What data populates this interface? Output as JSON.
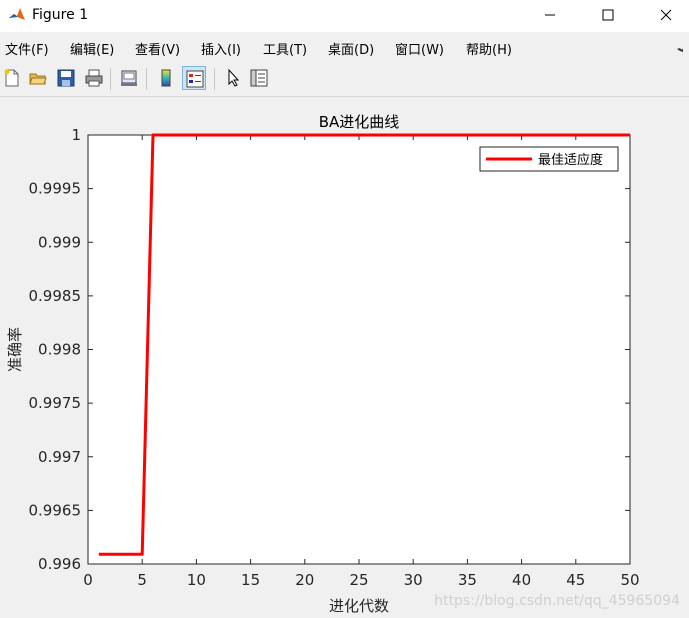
{
  "window": {
    "title": "Figure 1",
    "menu": [
      "文件(F)",
      "编辑(E)",
      "查看(V)",
      "插入(I)",
      "工具(T)",
      "桌面(D)",
      "窗口(W)",
      "帮助(H)"
    ]
  },
  "toolbar": {
    "icons": [
      "new-figure-icon",
      "open-file-icon",
      "save-icon",
      "print-icon",
      "link-plot-icon",
      "colorbar-icon",
      "legend-icon",
      "edit-plot-arrow-icon",
      "property-inspector-icon"
    ]
  },
  "chart_data": {
    "type": "line",
    "title": "BA进化曲线",
    "xlabel": "进化代数",
    "ylabel": "准确率",
    "xlim": [
      0,
      50
    ],
    "ylim": [
      0.996,
      1
    ],
    "xticks": [
      0,
      5,
      10,
      15,
      20,
      25,
      30,
      35,
      40,
      45,
      50
    ],
    "yticks": [
      0.996,
      0.9965,
      0.997,
      0.9975,
      0.998,
      0.9985,
      0.999,
      0.9995,
      1
    ],
    "ytick_labels": [
      "0.996",
      "0.9965",
      "0.997",
      "0.9975",
      "0.998",
      "0.9985",
      "0.999",
      "0.9995",
      "1"
    ],
    "grid": false,
    "legend_position": "top-right",
    "series": [
      {
        "name": "最佳适应度",
        "color": "#ff0000",
        "x": [
          1,
          2,
          3,
          4,
          5,
          6,
          7,
          8,
          9,
          10,
          11,
          12,
          13,
          14,
          15,
          16,
          17,
          18,
          19,
          20,
          21,
          22,
          23,
          24,
          25,
          26,
          27,
          28,
          29,
          30,
          31,
          32,
          33,
          34,
          35,
          36,
          37,
          38,
          39,
          40,
          41,
          42,
          43,
          44,
          45,
          46,
          47,
          48,
          49,
          50
        ],
        "y": [
          0.99609,
          0.99609,
          0.99609,
          0.99609,
          0.99609,
          1,
          1,
          1,
          1,
          1,
          1,
          1,
          1,
          1,
          1,
          1,
          1,
          1,
          1,
          1,
          1,
          1,
          1,
          1,
          1,
          1,
          1,
          1,
          1,
          1,
          1,
          1,
          1,
          1,
          1,
          1,
          1,
          1,
          1,
          1,
          1,
          1,
          1,
          1,
          1,
          1,
          1,
          1,
          1,
          1
        ]
      }
    ]
  },
  "watermark": "https://blog.csdn.net/qq_45965094"
}
